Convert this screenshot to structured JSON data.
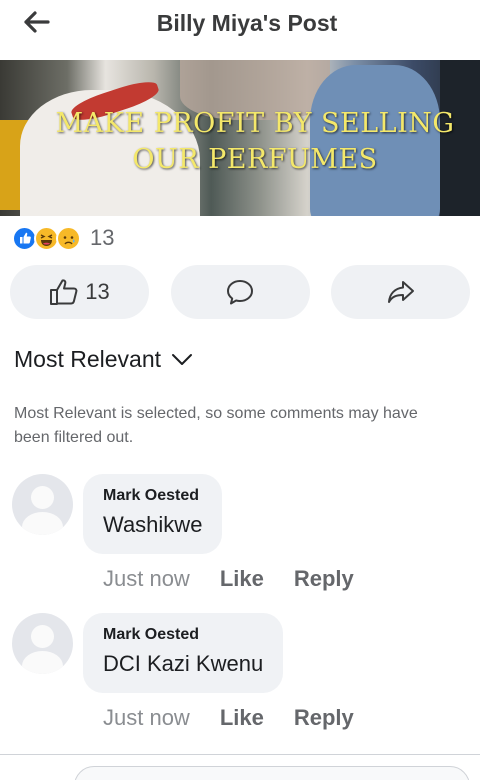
{
  "header": {
    "title": "Billy Miya's Post",
    "back_icon": "back-arrow-icon"
  },
  "media": {
    "overlay_text": "MAKE PROFIT BY SELLING OUR PERFUMES"
  },
  "reactions": {
    "icons": [
      "like-reaction-icon",
      "haha-reaction-icon",
      "sad-reaction-icon"
    ],
    "count": "13"
  },
  "actions": {
    "like": {
      "icon": "thumbs-up-icon",
      "count": "13"
    },
    "comment": {
      "icon": "comment-bubble-icon"
    },
    "share": {
      "icon": "share-arrow-icon"
    }
  },
  "sort": {
    "label": "Most Relevant"
  },
  "notice": "Most Relevant is selected, so some comments may have been filtered out.",
  "comments": [
    {
      "name": "Mark Oested",
      "text": "Washikwe",
      "time": "Just now",
      "like": "Like",
      "reply": "Reply"
    },
    {
      "name": "Mark Oested",
      "text": "DCI Kazi Kwenu",
      "time": "Just now",
      "like": "Like",
      "reply": "Reply"
    }
  ],
  "colors": {
    "like_blue": "#1877f2",
    "button_bg": "#eff1f4",
    "bubble_bg": "#f0f2f5",
    "secondary_text": "#65676b"
  }
}
